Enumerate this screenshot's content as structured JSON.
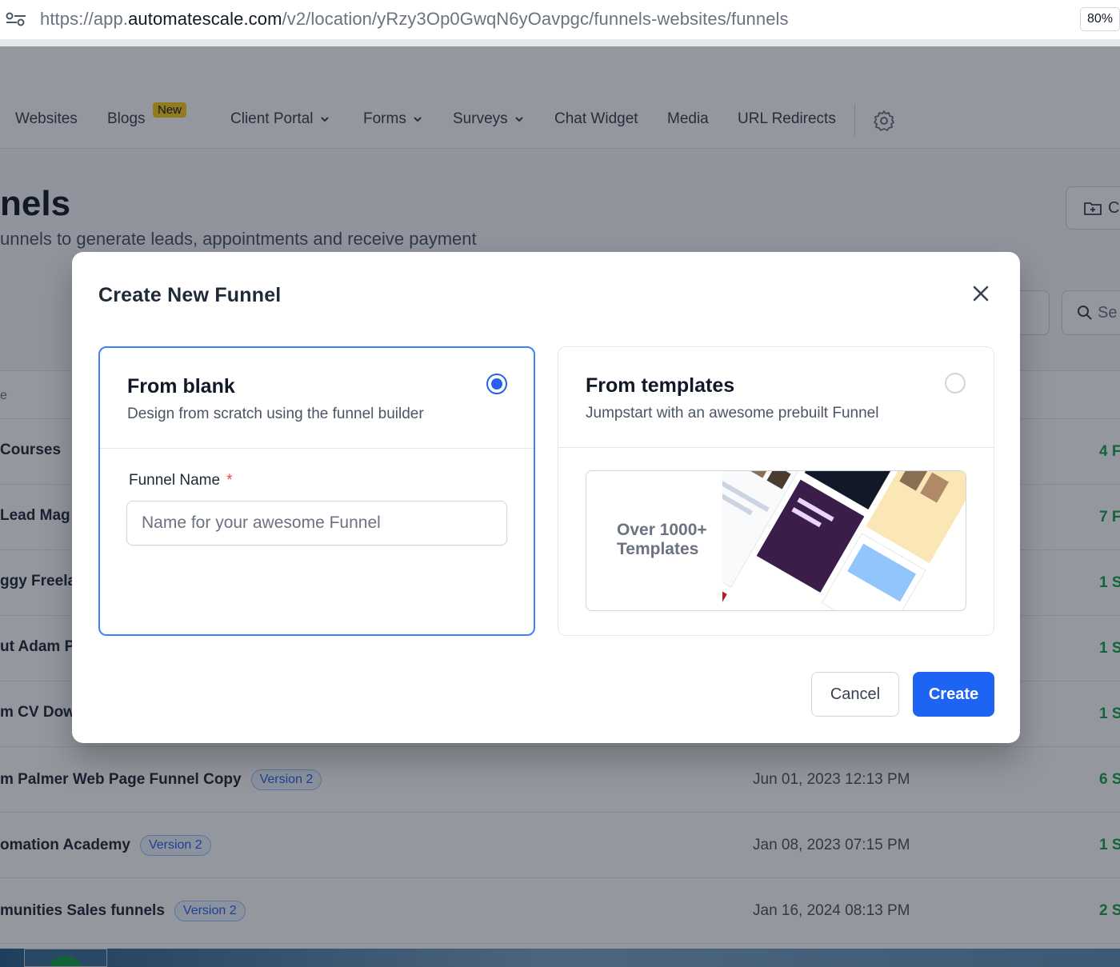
{
  "browser": {
    "url_prefix": "https://app.",
    "url_domain": "automatescale.com",
    "url_path": "/v2/location/yRzy3Op0GwqN6yOavpgc/funnels-websites/funnels",
    "zoom": "80%"
  },
  "nav": {
    "items": [
      {
        "label": "Websites"
      },
      {
        "label": "Blogs"
      },
      {
        "label": "Client Portal"
      },
      {
        "label": "Forms"
      },
      {
        "label": "Surveys"
      },
      {
        "label": "Chat Widget"
      },
      {
        "label": "Media"
      },
      {
        "label": "URL Redirects"
      }
    ],
    "new_badge": "New"
  },
  "page": {
    "title": "nels",
    "subtitle": "unnels to generate leads, appointments and receive payment",
    "create_folder_label": "C",
    "search_placeholder": "Se"
  },
  "table": {
    "header_fragment": "e",
    "rows": [
      {
        "name": "Courses",
        "version": "",
        "date": "",
        "steps": "4 F"
      },
      {
        "name": "Lead Mag",
        "version": "",
        "date": "",
        "steps": "7 F"
      },
      {
        "name": "ggy Freela",
        "version": "",
        "date": "",
        "steps": "1 S"
      },
      {
        "name": "ut Adam P",
        "version": "",
        "date": "",
        "steps": "1 S"
      },
      {
        "name": "m CV Dow",
        "version": "",
        "date": "",
        "steps": "1 S"
      },
      {
        "name": "m Palmer Web Page Funnel Copy",
        "version": "Version 2",
        "date": "Jun 01, 2023 12:13 PM",
        "steps": "6 S"
      },
      {
        "name": "omation Academy",
        "version": "Version 2",
        "date": "Jan 08, 2023 07:15 PM",
        "steps": "1 S"
      },
      {
        "name": "munities Sales funnels",
        "version": "Version 2",
        "date": "Jan 16, 2024 08:13 PM",
        "steps": "2 S"
      }
    ]
  },
  "modal": {
    "title": "Create New Funnel",
    "blank": {
      "title": "From blank",
      "description": "Design from scratch using the funnel builder",
      "selected": true
    },
    "templates": {
      "title": "From templates",
      "description": "Jumpstart with an awesome prebuilt Funnel",
      "selected": false,
      "preview_line1": "Over 1000+",
      "preview_line2": "Templates"
    },
    "field": {
      "label": "Funnel Name",
      "required_mark": "*",
      "placeholder": "Name for your awesome Funnel",
      "value": ""
    },
    "cancel_label": "Cancel",
    "create_label": "Create"
  },
  "colors": {
    "primary": "#1d64f2",
    "badge_yellow": "#facc15",
    "step_green": "#16a34a"
  }
}
